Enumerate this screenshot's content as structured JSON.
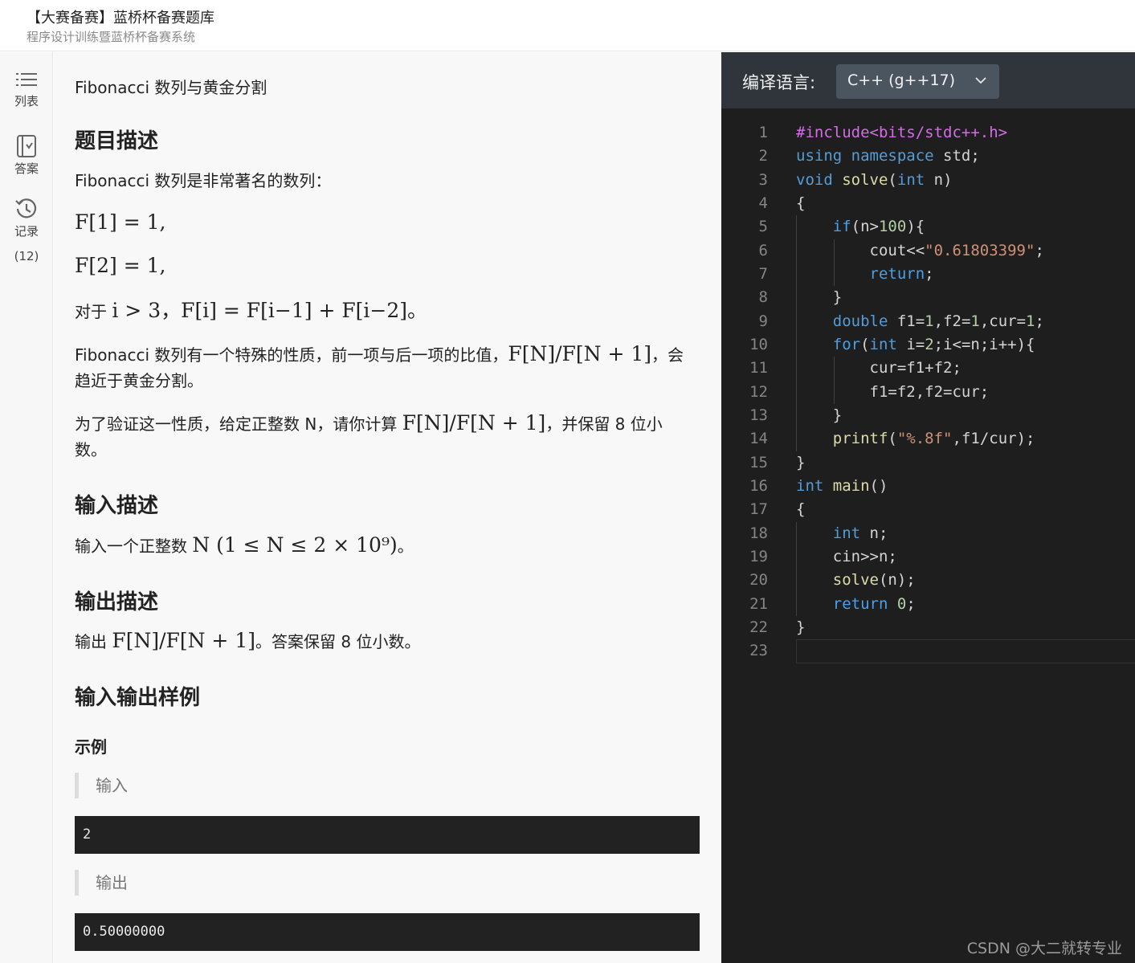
{
  "header": {
    "title": "【大赛备赛】蓝桥杯备赛题库",
    "subtitle": "程序设计训练暨蓝桥杯备赛系统"
  },
  "rail": {
    "list_label": "列表",
    "answer_label": "答案",
    "record_label": "记录",
    "record_count": "(12)"
  },
  "problem": {
    "title": "Fibonacci 数列与黄金分割",
    "desc_heading": "题目描述",
    "desc_intro": "Fibonacci 数列是非常著名的数列：",
    "f1": "F[1] = 1,",
    "f2": "F[2] = 1,",
    "recur_prefix": "对于",
    "recur_math": "i > 3，F[i] = F[i−1] + F[i−2]。",
    "property_text": "Fibonacci 数列有一个特殊的性质，前一项与后一项的比值，",
    "property_math": "F[N]/F[N + 1]",
    "property_suffix": "，会趋近于黄金分割。",
    "verify_text": "为了验证这一性质，给定正整数 N，请你计算",
    "verify_math": "F[N]/F[N + 1]",
    "verify_suffix": "，并保留 8 位小数。",
    "input_heading": "输入描述",
    "input_text": "输入一个正整数",
    "input_math": "N (1 ≤ N ≤ 2 × 10⁹)",
    "input_suffix": "。",
    "output_heading": "输出描述",
    "output_text": "输出",
    "output_math": "F[N]/F[N + 1]",
    "output_suffix": "。答案保留 8 位小数。",
    "sample_heading": "输入输出样例",
    "example_label": "示例",
    "sample_input_label": "输入",
    "sample_input": "2",
    "sample_output_label": "输出",
    "sample_output": "0.50000000"
  },
  "editor": {
    "lang_label": "编译语言:",
    "lang_value": "C++  (g++17)",
    "line_numbers": [
      "1",
      "2",
      "3",
      "4",
      "5",
      "6",
      "7",
      "8",
      "9",
      "10",
      "11",
      "12",
      "13",
      "14",
      "15",
      "16",
      "17",
      "18",
      "19",
      "20",
      "21",
      "22",
      "23"
    ]
  },
  "watermark": "CSDN @大二就转专业"
}
